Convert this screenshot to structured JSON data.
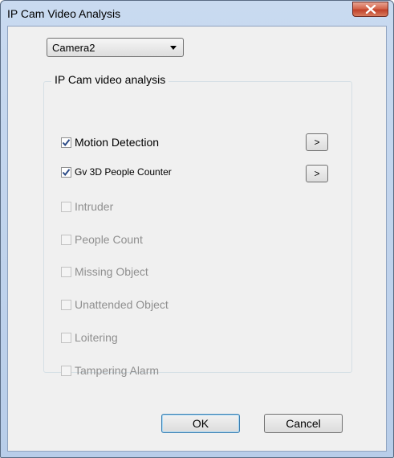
{
  "window": {
    "title": "IP Cam Video Analysis",
    "close_icon": "close-x-icon"
  },
  "camera_select": {
    "value": "Camera2"
  },
  "group": {
    "title": "IP Cam video analysis"
  },
  "options": [
    {
      "label": "Motion Detection",
      "checked": true,
      "enabled": true
    },
    {
      "label": "Gv 3D People Counter",
      "checked": true,
      "enabled": true
    },
    {
      "label": "Intruder",
      "checked": false,
      "enabled": false
    },
    {
      "label": "People Count",
      "checked": false,
      "enabled": false
    },
    {
      "label": "Missing Object",
      "checked": false,
      "enabled": false
    },
    {
      "label": "Unattended Object",
      "checked": false,
      "enabled": false
    },
    {
      "label": "Loitering",
      "checked": false,
      "enabled": false
    },
    {
      "label": "Tampering Alarm",
      "checked": false,
      "enabled": false
    }
  ],
  "settings_buttons": {
    "motion_detection": ">",
    "people_counter": ">"
  },
  "footer": {
    "ok_label": "OK",
    "cancel_label": "Cancel"
  },
  "colors": {
    "disabled_text": "#8f8f8f",
    "check_mark": "#2b4a86"
  }
}
